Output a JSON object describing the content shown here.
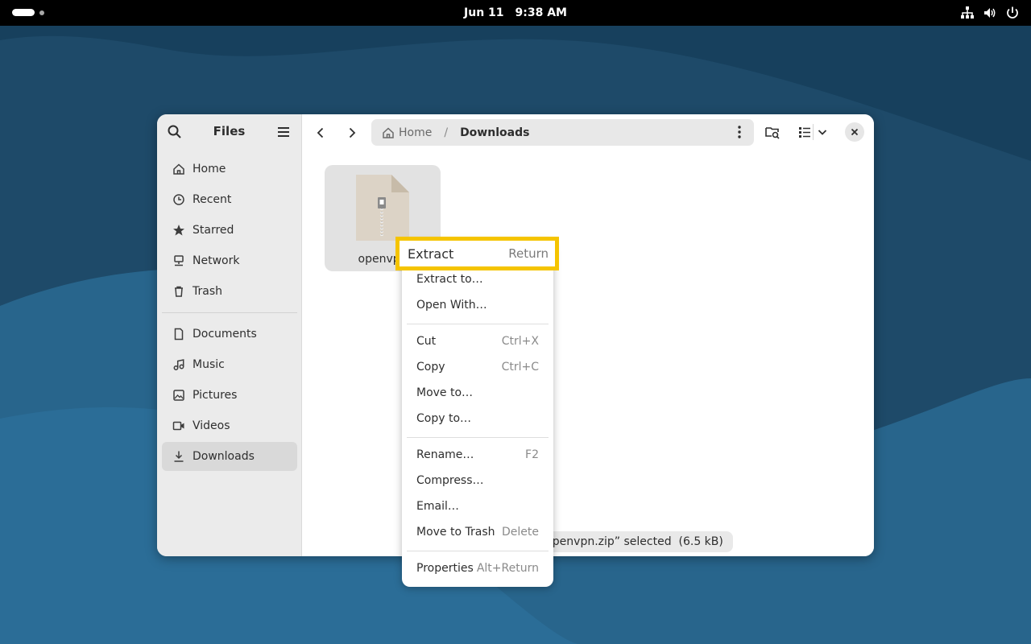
{
  "topbar": {
    "date": "Jun 11",
    "time": "9:38 AM",
    "tray_icons": [
      "network-icon",
      "volume-icon",
      "power-icon"
    ]
  },
  "sidebar": {
    "title": "Files",
    "places": [
      {
        "label": "Home",
        "icon": "home-icon"
      },
      {
        "label": "Recent",
        "icon": "clock-icon"
      },
      {
        "label": "Starred",
        "icon": "star-icon"
      },
      {
        "label": "Network",
        "icon": "network-icon"
      },
      {
        "label": "Trash",
        "icon": "trash-icon"
      }
    ],
    "bookmarks": [
      {
        "label": "Documents",
        "icon": "document-icon"
      },
      {
        "label": "Music",
        "icon": "music-icon"
      },
      {
        "label": "Pictures",
        "icon": "picture-icon"
      },
      {
        "label": "Videos",
        "icon": "video-icon"
      },
      {
        "label": "Downloads",
        "icon": "download-icon",
        "active": true
      }
    ]
  },
  "pathbar": {
    "home": "Home",
    "separator": "/",
    "current": "Downloads"
  },
  "file": {
    "name": "openvpn.zip",
    "visible_name": "openvpn"
  },
  "status": {
    "text": "“openvpn.zip” selected  (6.5 kB)"
  },
  "context_menu": {
    "highlighted": {
      "label": "Extract",
      "accel": "Return"
    },
    "items": [
      {
        "label": "Extract to…",
        "accel": ""
      },
      {
        "label": "Open With…",
        "accel": ""
      },
      {
        "label": "Cut",
        "accel": "Ctrl+X"
      },
      {
        "label": "Copy",
        "accel": "Ctrl+C"
      },
      {
        "label": "Move to…",
        "accel": ""
      },
      {
        "label": "Copy to…",
        "accel": ""
      },
      {
        "label": "Rename…",
        "accel": "F2"
      },
      {
        "label": "Compress…",
        "accel": ""
      },
      {
        "label": "Email…",
        "accel": ""
      },
      {
        "label": "Move to Trash",
        "accel": "Delete"
      },
      {
        "label": "Properties",
        "accel": "Alt+Return"
      }
    ]
  },
  "colors": {
    "highlight_border": "#f5c400",
    "wallpaper_dark": "#1f4d6e",
    "wallpaper_light": "#2a6a92"
  }
}
